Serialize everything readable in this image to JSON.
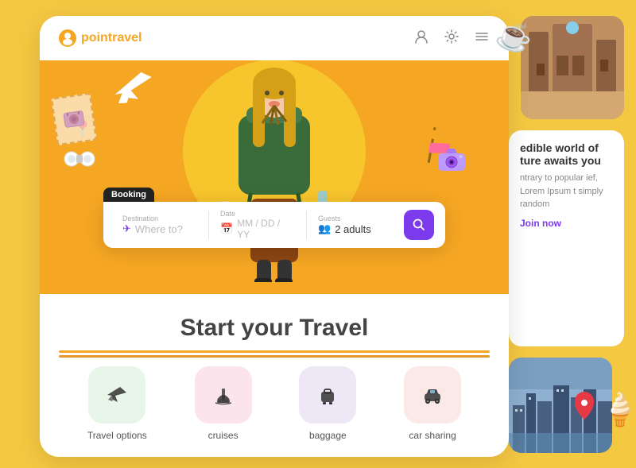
{
  "app": {
    "name": "pointravel",
    "logo_text": "pointravel"
  },
  "header": {
    "profile_icon": "👤",
    "settings_icon": "⚙",
    "menu_icon": "☰"
  },
  "booking": {
    "label": "Booking",
    "destination_label": "Destination",
    "destination_placeholder": "Where to?",
    "date_label": "Date",
    "date_placeholder": "MM / DD / YY",
    "guests_label": "Guests",
    "guests_value": "2 adults",
    "search_icon": "🔍"
  },
  "hero": {
    "title": "Start your Travel"
  },
  "categories": [
    {
      "id": "travel",
      "icon": "✈",
      "label": "Travel options",
      "color": "cat-green"
    },
    {
      "id": "cruises",
      "icon": "🛳",
      "label": "cruises",
      "color": "cat-pink"
    },
    {
      "id": "baggage",
      "icon": "💼",
      "label": "baggage",
      "color": "cat-lavender"
    },
    {
      "id": "car",
      "icon": "🚗",
      "label": "car sharing",
      "color": "cat-salmon"
    }
  ],
  "side_panel": {
    "card_title": "edible world of ture awaits you",
    "card_text": "ntrary to popular ief, Lorem Ipsum t simply random",
    "join_label": "Join now"
  },
  "decorators": {
    "airplane": "✈",
    "pin": "📍",
    "camera": "📷",
    "binoculars": "🔭",
    "signpost": "🪧",
    "coffee": "☕",
    "icecream": "🍦"
  }
}
